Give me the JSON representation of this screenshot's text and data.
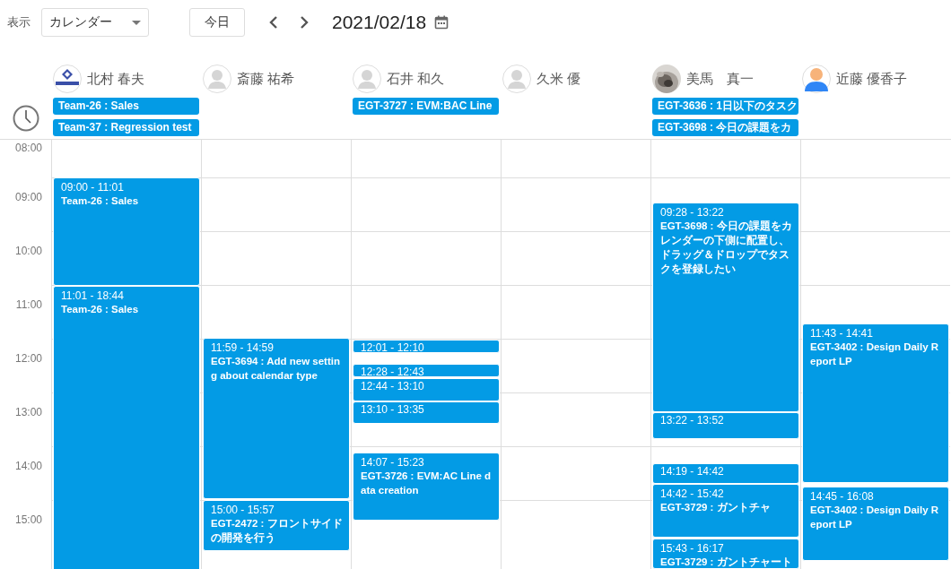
{
  "toolbar": {
    "view_label": "表示",
    "view_select": "カレンダー",
    "today_button": "今日",
    "date": "2021/02/18"
  },
  "hours": [
    "08:00",
    "09:00",
    "10:00",
    "11:00",
    "12:00",
    "13:00",
    "14:00",
    "15:00"
  ],
  "people": [
    {
      "name": "北村 春夫",
      "avatar": {
        "kind": "logo"
      },
      "all_day": [
        "Team-26 : Sales",
        "Team-37 : Regression test"
      ],
      "events": [
        {
          "time": "09:00 - 11:01",
          "title": "Team-26 : Sales"
        },
        {
          "time": "11:01 - 18:44",
          "title": "Team-26 : Sales"
        }
      ]
    },
    {
      "name": "斎藤 祐希",
      "avatar": {
        "kind": "default"
      },
      "events": [
        {
          "time": "11:59 - 14:59",
          "title": "EGT-3694 : Add new setting about calendar type"
        },
        {
          "time": "15:00 - 15:57",
          "title": "EGT-2472 : フロントサイドの開発を行う"
        }
      ]
    },
    {
      "name": "石井 和久",
      "avatar": {
        "kind": "default"
      },
      "all_day": [
        "EGT-3727 : EVM:BAC Line"
      ],
      "events": [
        {
          "time": "12:01 - 12:10"
        },
        {
          "time": "12:28 - 12:43"
        },
        {
          "time": "12:44 - 13:10"
        },
        {
          "time": "13:10 - 13:35"
        },
        {
          "time": "14:07 - 15:23",
          "title": "EGT-3726 : EVM:AC Line data creation"
        }
      ]
    },
    {
      "name": "久米 優",
      "avatar": {
        "kind": "default"
      }
    },
    {
      "name": "美馬　真一",
      "avatar": {
        "kind": "picture"
      },
      "all_day": [
        "EGT-3636 : 1日以下のタスク",
        "EGT-3698 : 今日の課題をカ"
      ],
      "events": [
        {
          "time": "09:28 - 13:22",
          "title": "EGT-3698 : 今日の課題をカレンダーの下側に配置し、ドラッグ＆ドロップでタスクを登録したい"
        },
        {
          "time": "13:22 - 13:52"
        },
        {
          "time": "14:19 - 14:42"
        },
        {
          "time": "14:42 - 15:42",
          "title": "EGT-3729 : ガントチャ"
        },
        {
          "time": "15:43 - 16:17",
          "title": "EGT-3729 : ガントチャート"
        }
      ]
    },
    {
      "name": "近藤 優香子",
      "avatar": {
        "kind": "person"
      },
      "events": [
        {
          "time": "11:43 - 14:41",
          "title": "EGT-3402 : Design Daily Report LP"
        },
        {
          "time": "14:45 - 16:08",
          "title": "EGT-3402 : Design Daily Report LP"
        }
      ]
    }
  ]
}
